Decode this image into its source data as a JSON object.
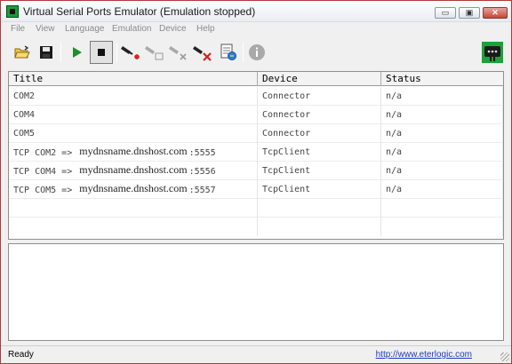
{
  "window": {
    "title": "Virtual Serial Ports Emulator (Emulation stopped)",
    "minimize_glyph": "▭",
    "maximize_glyph": "▣",
    "close_glyph": "✕"
  },
  "menu": [
    "File",
    "View",
    "Language",
    "Emulation",
    "Device",
    "Help"
  ],
  "toolbar": {
    "icons": [
      "open-folder-icon",
      "save-icon",
      "play-icon",
      "stop-icon",
      "new-device-icon",
      "device-properties-icon",
      "device-disabled-icon",
      "delete-device-icon",
      "device-report-icon",
      "info-icon",
      "serial-connector-logo-icon"
    ],
    "accent_play": "#1f8f2a",
    "accent_delete": "#d42020"
  },
  "grid": {
    "columns": [
      "Title",
      "Device",
      "Status"
    ],
    "rows": [
      {
        "title": "COM2",
        "host": "",
        "port": "",
        "device": "Connector",
        "status": "n/a"
      },
      {
        "title": "COM4",
        "host": "",
        "port": "",
        "device": "Connector",
        "status": "n/a"
      },
      {
        "title": "COM5",
        "host": "",
        "port": "",
        "device": "Connector",
        "status": "n/a"
      },
      {
        "title": "TCP COM2 =>",
        "host": "mydnsname.dnshost.com",
        "port": ":5555",
        "device": "TcpClient",
        "status": "n/a"
      },
      {
        "title": "TCP COM4 =>",
        "host": "mydnsname.dnshost.com",
        "port": ":5556",
        "device": "TcpClient",
        "status": "n/a"
      },
      {
        "title": "TCP COM5 =>",
        "host": "mydnsname.dnshost.com",
        "port": ":5557",
        "device": "TcpClient",
        "status": "n/a"
      }
    ]
  },
  "status": {
    "text": "Ready",
    "link": "http://www.eterlogic.com"
  }
}
